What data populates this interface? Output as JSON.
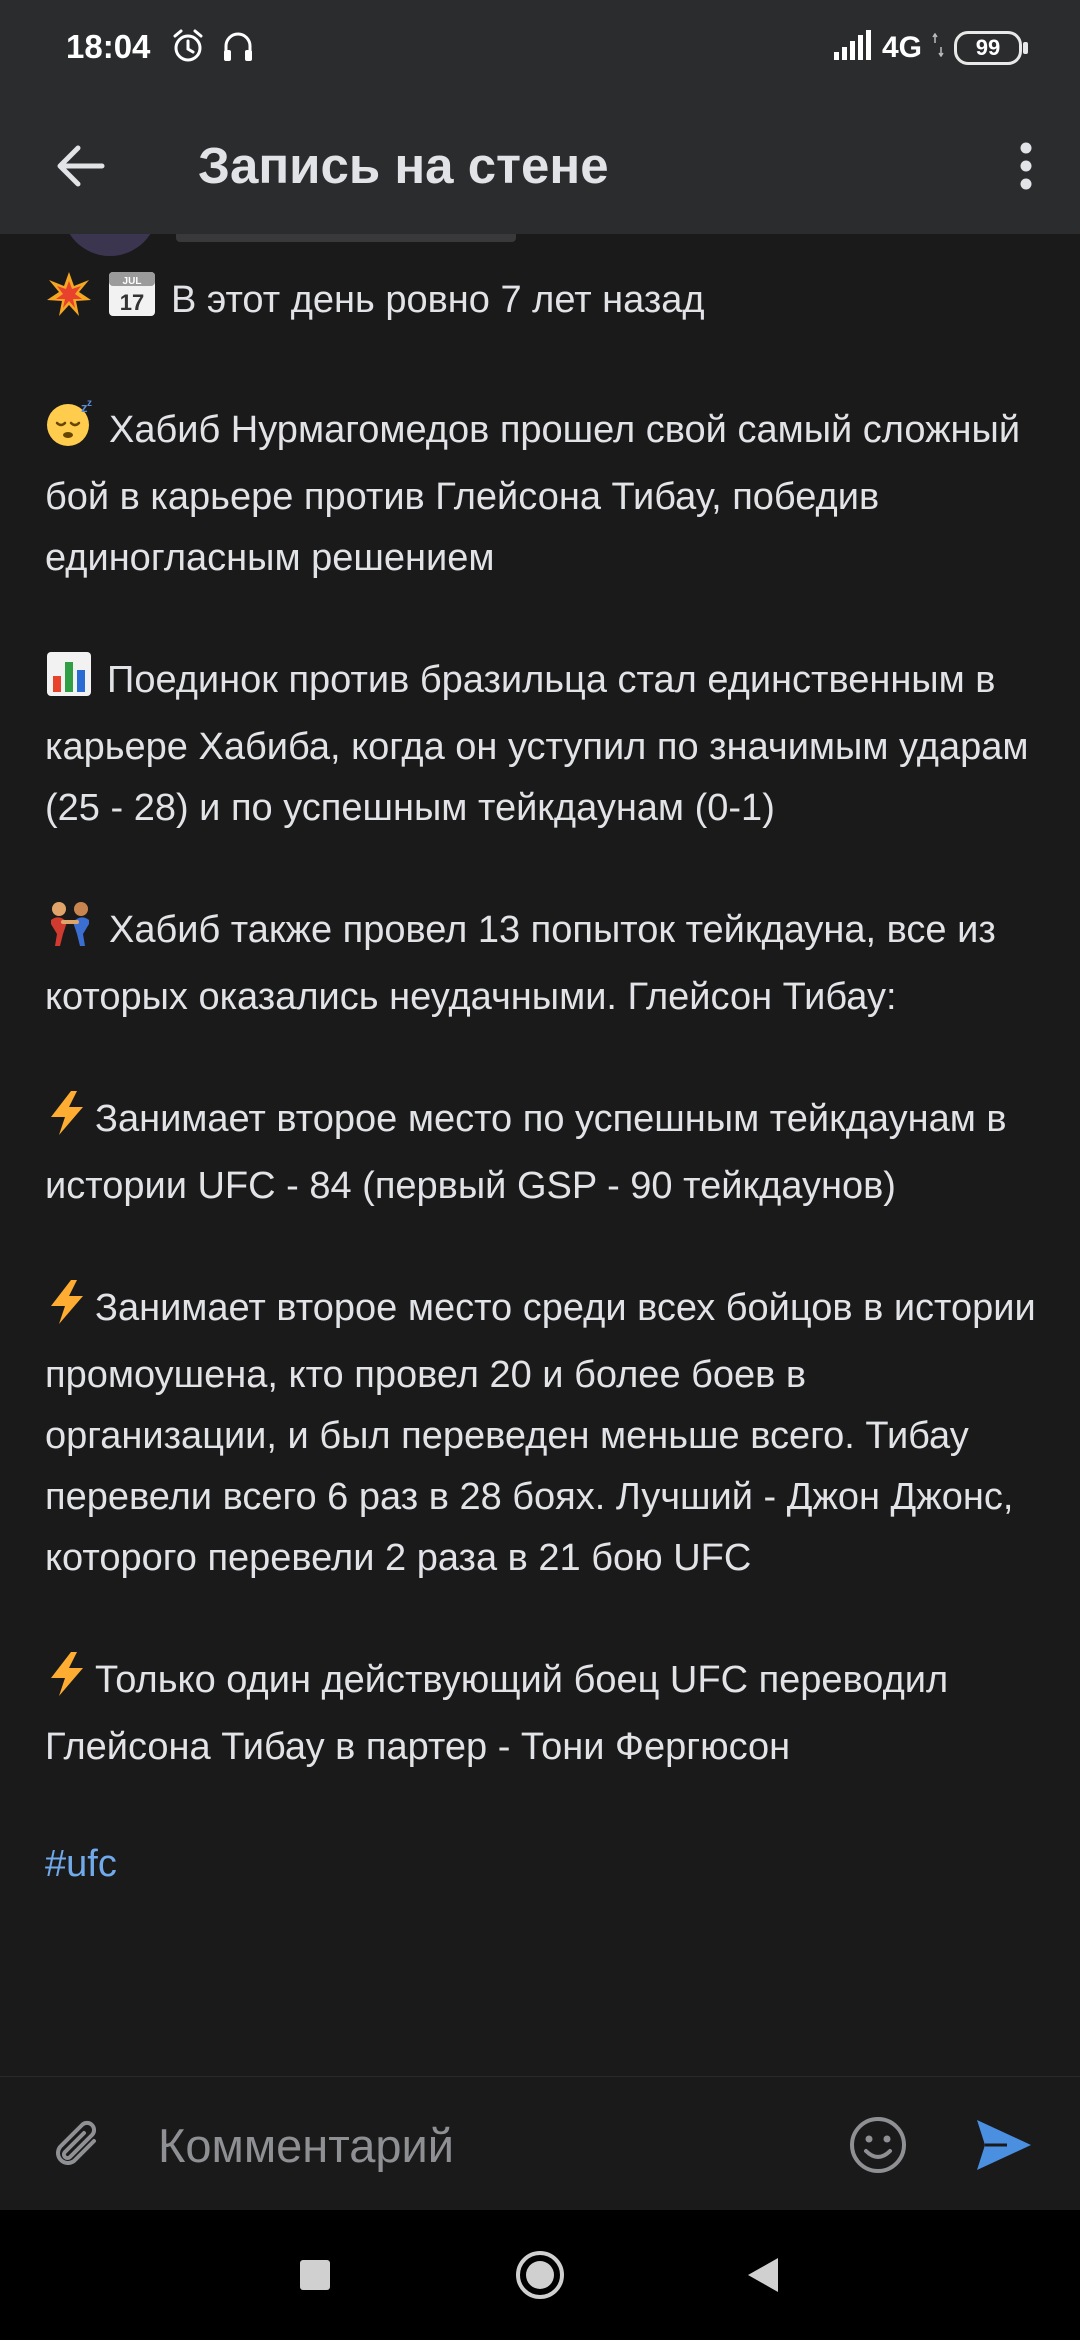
{
  "status_bar": {
    "time": "18:04",
    "network": "4G",
    "battery": "99"
  },
  "header": {
    "title": "Запись на стене"
  },
  "post": {
    "paragraphs": [
      {
        "icon": "collision-emoji calendar-emoji",
        "text": "В этот день ровно 7 лет назад"
      },
      {
        "icon": "sleeping-face-emoji",
        "text": "Хабиб Нурмагомедов прошел свой самый сложный бой в карьере против Глейсона Тибау, победив единогласным решением"
      },
      {
        "icon": "bar-chart-emoji",
        "text": "Поединок против бразильца стал единственным в карьере Хабиба, когда он уступил по значимым ударам (25 - 28) и по успешным тейкдаунам (0-1)"
      },
      {
        "icon": "wrestlers-emoji",
        "text": "Хабиб также провел 13 попыток тейкдауна, все из которых оказались неудачными. Глейсон Тибау:"
      },
      {
        "icon": "lightning-emoji",
        "text": "Занимает второе место по успешным тейкдаунам в истории UFC - 84 (первый GSP - 90 тейкдаунов)"
      },
      {
        "icon": "lightning-emoji",
        "text": "Занимает второе место среди всех бойцов в истории промоушена, кто провел 20 и более боев в организации, и был переведен меньше всего. Тибау перевели всего 6 раз в 28 боях. Лучший - Джон Джонс, которого перевели 2 раза в 21 бою UFC"
      },
      {
        "icon": "lightning-emoji",
        "text": "Только один действующий боец UFC переводил Глейсона Тибау в партер - Тони Фергюсон"
      }
    ],
    "calendar_month": "JUL",
    "calendar_day": "17",
    "hashtag": "#ufc"
  },
  "comment": {
    "placeholder": "Комментарий"
  },
  "colors": {
    "background": "#1a1a1b",
    "header": "#2b2c2e",
    "text": "#e1e3e6",
    "accent": "#71aaeb",
    "placeholder": "#8e9093"
  }
}
